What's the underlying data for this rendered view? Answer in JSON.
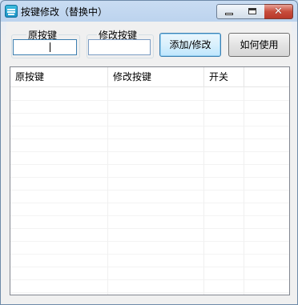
{
  "window": {
    "title": "按键修改（替换中）",
    "icon": "keyboard-icon",
    "controls": {
      "minimize": "minimize-icon",
      "maximize": "maximize-icon",
      "close_glyph": "✕"
    }
  },
  "form": {
    "original_key": {
      "label": "原按键",
      "value": ""
    },
    "modified_key": {
      "label": "修改按键",
      "value": ""
    },
    "add_button_label": "添加/修改",
    "help_button_label": "如何使用"
  },
  "table": {
    "columns": [
      "原按键",
      "修改按键",
      "开关",
      ""
    ],
    "rows": []
  },
  "colors": {
    "titlebar": "#bcd3ee",
    "close_button": "#c74d3c",
    "focus_border": "#3c7fb1",
    "dialog_bg": "#f0f0f0"
  }
}
